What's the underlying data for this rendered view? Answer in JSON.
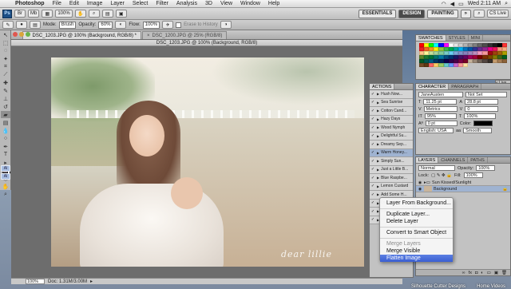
{
  "menubar": {
    "app": "Photoshop",
    "items": [
      "File",
      "Edit",
      "Image",
      "Layer",
      "Select",
      "Filter",
      "Analysis",
      "3D",
      "View",
      "Window",
      "Help"
    ],
    "clock": "Wed 2:11 AM",
    "live": "CS Live"
  },
  "appbar": {
    "logo": "Ps",
    "zoom": "100%",
    "workspaces": [
      "ESSENTIALS",
      "DESIGN",
      "PAINTING"
    ],
    "active_workspace": "DESIGN",
    "more": "»"
  },
  "options": {
    "mode_label": "Mode:",
    "mode_value": "Brush",
    "opacity_label": "Opacity:",
    "opacity_value": "60%",
    "flow_label": "Flow:",
    "flow_value": "100%",
    "erase_history": "Erase to History"
  },
  "document": {
    "tab1": "DSC_1203.JPG @ 100% (Background, RGB/8) *",
    "tab2": "DSC_1200.JPG @ 25% (RGB/8)",
    "title": "DSC_1203.JPG @ 100% (Background, RGB/8)",
    "watermark": "dear lillie",
    "zoom": "100%",
    "doc_info": "Doc: 1.31M/3.00M"
  },
  "swatches_panel": {
    "tabs": [
      "SWATCHES",
      "STYLES",
      "MINI"
    ],
    "colors": [
      "#ff0000",
      "#ffff00",
      "#00ff00",
      "#00ffff",
      "#0000ff",
      "#ff00ff",
      "#ffffff",
      "#e6e6e6",
      "#cccccc",
      "#b3b3b3",
      "#999999",
      "#808080",
      "#666666",
      "#4d4d4d",
      "#333333",
      "#1a1a1a",
      "#000000",
      "#ff3333",
      "#ee1d24",
      "#f26522",
      "#f7941d",
      "#fff200",
      "#8dc63f",
      "#39b54a",
      "#00a651",
      "#00a99d",
      "#00aeef",
      "#0072bc",
      "#0054a6",
      "#2e3192",
      "#662d91",
      "#92278f",
      "#ec008c",
      "#ed145b",
      "#f69679",
      "#f9ad81",
      "#fdc689",
      "#fff799",
      "#c4df9b",
      "#a3d39c",
      "#82ca9d",
      "#7accc8",
      "#6dcff6",
      "#7da7d9",
      "#8393ca",
      "#8882be",
      "#a187be",
      "#bc8dbf",
      "#f49ac2",
      "#f6989d",
      "#9e0b0f",
      "#a0410d",
      "#a36209",
      "#aba000",
      "#598527",
      "#1a7b30",
      "#007236",
      "#00746b",
      "#0076a3",
      "#004b80",
      "#003471",
      "#1b1464",
      "#440e62",
      "#630460",
      "#9e005d",
      "#9e0039",
      "#790000",
      "#7b2e00",
      "#7d4900",
      "#827b00",
      "#406618",
      "#005e20",
      "#005826",
      "#005952",
      "#005b7f",
      "#003663",
      "#002157",
      "#0d004c",
      "#32004b",
      "#4b0049",
      "#7b0046",
      "#7a0026",
      "#c7b299",
      "#998675",
      "#736357",
      "#534741",
      "#37302a",
      "#c69c6d",
      "#a67c52",
      "#8c6239",
      "#754c24",
      "#603913",
      "#ff6666",
      "#ffcc66",
      "#99cc66",
      "#66cccc",
      "#6699ff",
      "#cc66cc",
      "#ff9999",
      "#ffe0a3"
    ]
  },
  "adjust_panel": {
    "label": "« Live"
  },
  "character_panel": {
    "tabs": [
      "CHARACTER",
      "PARAGRAPH"
    ],
    "font": "JaneAusten",
    "style": "Not Set",
    "size": "11.25 pt",
    "leading": "28.8 pt",
    "tracking_v": "Metrics",
    "tracking": "0",
    "vscale": "95%",
    "hscale": "100%",
    "baseline": "0 pt",
    "color_label": "Color:",
    "language": "English: USA",
    "aa_label": "aa",
    "aa_value": "Smooth"
  },
  "layers_panel": {
    "tabs": [
      "LAYERS",
      "CHANNELS",
      "PATHS"
    ],
    "blend": "Normal",
    "opacity_label": "Opacity:",
    "opacity": "100%",
    "lock_label": "Lock:",
    "fill_label": "Fill:",
    "fill": "100%",
    "layers": [
      {
        "name": "Sun Kissed/Sunlight"
      },
      {
        "name": "Background"
      }
    ]
  },
  "actions_panel": {
    "tab": "ACTIONS",
    "items": [
      {
        "label": "Hush Now..."
      },
      {
        "label": "Sea Sunrise"
      },
      {
        "label": "Cotton Cand..."
      },
      {
        "label": "Hazy Days"
      },
      {
        "label": "Wood Nymph"
      },
      {
        "label": "Delightful Su..."
      },
      {
        "label": "Dreamy Sep..."
      },
      {
        "label": "Warm Honey..."
      },
      {
        "label": "Simply Sun..."
      },
      {
        "label": "Just a Little B..."
      },
      {
        "label": "Blue Raspbe..."
      },
      {
        "label": "Lemon Custard"
      },
      {
        "label": "Add Some H..."
      },
      {
        "label": "Dreamy Rain..."
      },
      {
        "label": "Berrrr Hazy..."
      },
      {
        "label": "Miracle Maker"
      }
    ]
  },
  "context_menu": {
    "items": [
      {
        "label": "Layer From Background...",
        "enabled": true
      },
      {
        "sep": true
      },
      {
        "label": "Duplicate Layer...",
        "enabled": true
      },
      {
        "label": "Delete Layer",
        "enabled": true
      },
      {
        "sep": true
      },
      {
        "label": "Convert to Smart Object",
        "enabled": true
      },
      {
        "sep": true
      },
      {
        "label": "Merge Layers",
        "enabled": false
      },
      {
        "label": "Merge Visible",
        "enabled": true
      },
      {
        "label": "Flatten Image",
        "enabled": true,
        "highlight": true
      }
    ]
  },
  "desktop": {
    "left_icons": [
      "Al",
      "Al"
    ],
    "bottom": [
      "Silhouette Cutter Designs",
      "Home Videos"
    ]
  }
}
